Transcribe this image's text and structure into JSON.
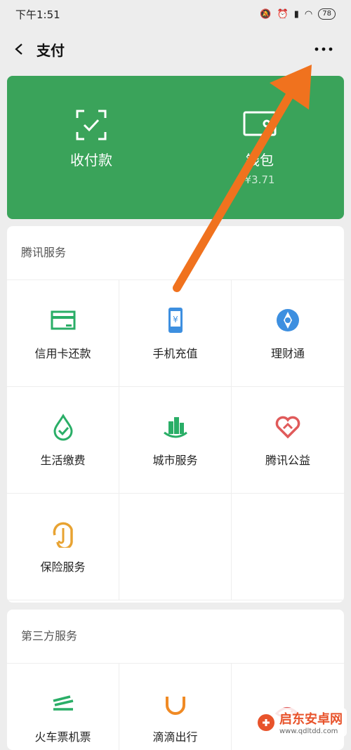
{
  "status": {
    "time": "下午1:51",
    "battery": "78"
  },
  "header": {
    "title": "支付"
  },
  "green": {
    "items": [
      {
        "label": "收付款",
        "sub": ""
      },
      {
        "label": "钱包",
        "sub": "¥3.71"
      }
    ]
  },
  "tencent": {
    "title": "腾讯服务",
    "items": [
      {
        "label": "信用卡还款",
        "icon": "credit-card-icon",
        "color": "#2aae67"
      },
      {
        "label": "手机充值",
        "icon": "phone-topup-icon",
        "color": "#3d8fe0"
      },
      {
        "label": "理财通",
        "icon": "wealth-icon",
        "color": "#3d8fe0"
      },
      {
        "label": "生活缴费",
        "icon": "utility-icon",
        "color": "#2aae67"
      },
      {
        "label": "城市服务",
        "icon": "city-icon",
        "color": "#2aae67"
      },
      {
        "label": "腾讯公益",
        "icon": "charity-heart-icon",
        "color": "#e05a5a"
      },
      {
        "label": "保险服务",
        "icon": "insurance-umbrella-icon",
        "color": "#e8a332"
      }
    ]
  },
  "third": {
    "title": "第三方服务",
    "items": [
      {
        "label": "火车票机票",
        "icon": "train-icon",
        "color": "#2aae67"
      },
      {
        "label": "滴滴出行",
        "icon": "didi-icon",
        "color": "#f08a24"
      },
      {
        "label": "",
        "icon": "fish-icon",
        "color": "#e05a5a"
      }
    ]
  },
  "watermark": {
    "name": "启东安卓网",
    "url": "www.qdltdd.com"
  }
}
